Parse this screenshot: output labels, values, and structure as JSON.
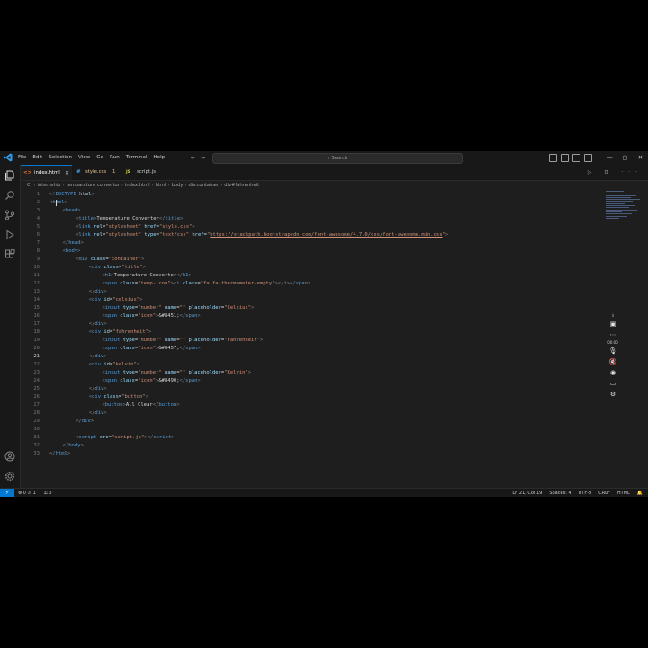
{
  "menu": [
    "File",
    "Edit",
    "Selection",
    "View",
    "Go",
    "Run",
    "Terminal",
    "Help"
  ],
  "nav": {
    "back": "←",
    "forward": "→"
  },
  "search": {
    "placeholder": "Search"
  },
  "window_controls": {
    "minimize": "—",
    "restore": "▢",
    "close": "✕"
  },
  "tabs": [
    {
      "icon": "<>",
      "label": "index.html",
      "close": "✕",
      "active": true,
      "color": "#e37933"
    },
    {
      "icon": "#",
      "label": "style.css",
      "badge": "1",
      "active": false,
      "color": "#42a5f5",
      "label_color": "#e2c08d"
    },
    {
      "icon": "JS",
      "label": "script.js",
      "active": false,
      "color": "#cbcb41"
    }
  ],
  "tab_actions": "▷ ⊡ ···",
  "breadcrumb": [
    "C:",
    "internship",
    "temparature convertor",
    "index.html",
    "html",
    "body",
    "div.container",
    "div#fahrenheit"
  ],
  "editor": {
    "current_line": 21,
    "lines": [
      {
        "n": "1",
        "i": 0,
        "p": [
          [
            "br",
            "<!"
          ],
          [
            "tag",
            "DOCTYPE"
          ],
          [
            "attr",
            " html"
          ],
          [
            "br",
            ">"
          ]
        ]
      },
      {
        "n": "2",
        "i": 0,
        "p": [
          [
            "br",
            "<"
          ],
          [
            "tag",
            "html"
          ],
          [
            "br",
            ">"
          ]
        ]
      },
      {
        "n": "3",
        "i": 1,
        "p": [
          [
            "br",
            "<"
          ],
          [
            "tag",
            "head"
          ],
          [
            "br",
            ">"
          ]
        ]
      },
      {
        "n": "4",
        "i": 2,
        "p": [
          [
            "br",
            "<"
          ],
          [
            "tag",
            "title"
          ],
          [
            "br",
            ">"
          ],
          [
            "txt",
            "Temperature Converter"
          ],
          [
            "br",
            "</"
          ],
          [
            "tag",
            "title"
          ],
          [
            "br",
            ">"
          ]
        ]
      },
      {
        "n": "5",
        "i": 2,
        "p": [
          [
            "br",
            "<"
          ],
          [
            "tag",
            "link"
          ],
          [
            "attr",
            " rel"
          ],
          [
            "txt",
            "="
          ],
          [
            "str",
            "\"stylesheet\""
          ],
          [
            "attr",
            " href"
          ],
          [
            "txt",
            "="
          ],
          [
            "str",
            "\"style.css\""
          ],
          [
            "br",
            ">"
          ]
        ]
      },
      {
        "n": "6",
        "i": 2,
        "p": [
          [
            "br",
            "<"
          ],
          [
            "tag",
            "link"
          ],
          [
            "attr",
            " rel"
          ],
          [
            "txt",
            "="
          ],
          [
            "str",
            "\"stylesheet\""
          ],
          [
            "attr",
            " type"
          ],
          [
            "txt",
            "="
          ],
          [
            "str",
            "\"text/css\""
          ],
          [
            "attr",
            " href"
          ],
          [
            "txt",
            "="
          ],
          [
            "str",
            "\""
          ],
          [
            "url",
            "https://stackpath.bootstrapcdn.com/font-awesome/4.7.0/css/font-awesome.min.css"
          ],
          [
            "str",
            "\""
          ],
          [
            "br",
            ">"
          ]
        ]
      },
      {
        "n": "7",
        "i": 1,
        "p": [
          [
            "br",
            "</"
          ],
          [
            "tag",
            "head"
          ],
          [
            "br",
            ">"
          ]
        ]
      },
      {
        "n": "8",
        "i": 1,
        "p": [
          [
            "br",
            "<"
          ],
          [
            "tag",
            "body"
          ],
          [
            "br",
            ">"
          ]
        ]
      },
      {
        "n": "9",
        "i": 2,
        "p": [
          [
            "br",
            "<"
          ],
          [
            "tag",
            "div"
          ],
          [
            "attr",
            " class"
          ],
          [
            "txt",
            "="
          ],
          [
            "str",
            "\"container\""
          ],
          [
            "br",
            ">"
          ]
        ]
      },
      {
        "n": "10",
        "i": 3,
        "p": [
          [
            "br",
            "<"
          ],
          [
            "tag",
            "div"
          ],
          [
            "attr",
            " class"
          ],
          [
            "txt",
            "="
          ],
          [
            "str",
            "\"title\""
          ],
          [
            "br",
            ">"
          ]
        ]
      },
      {
        "n": "11",
        "i": 4,
        "p": [
          [
            "br",
            "<"
          ],
          [
            "tag",
            "h1"
          ],
          [
            "br",
            ">"
          ],
          [
            "txt",
            "Temperature Converter"
          ],
          [
            "br",
            "</"
          ],
          [
            "tag",
            "h1"
          ],
          [
            "br",
            ">"
          ]
        ]
      },
      {
        "n": "12",
        "i": 4,
        "p": [
          [
            "br",
            "<"
          ],
          [
            "tag",
            "span"
          ],
          [
            "attr",
            " class"
          ],
          [
            "txt",
            "="
          ],
          [
            "str",
            "\"temp-icon\""
          ],
          [
            "br",
            "><"
          ],
          [
            "tag",
            "i"
          ],
          [
            "attr",
            " class"
          ],
          [
            "txt",
            "="
          ],
          [
            "str",
            "\"fa fa-thermometer-empty\""
          ],
          [
            "br",
            "></"
          ],
          [
            "tag",
            "i"
          ],
          [
            "br",
            "></"
          ],
          [
            "tag",
            "span"
          ],
          [
            "br",
            ">"
          ]
        ]
      },
      {
        "n": "13",
        "i": 3,
        "p": [
          [
            "br",
            "</"
          ],
          [
            "tag",
            "div"
          ],
          [
            "br",
            ">"
          ]
        ]
      },
      {
        "n": "14",
        "i": 3,
        "p": [
          [
            "br",
            "<"
          ],
          [
            "tag",
            "div"
          ],
          [
            "attr",
            " id"
          ],
          [
            "txt",
            "="
          ],
          [
            "str",
            "\"celsius\""
          ],
          [
            "br",
            ">"
          ]
        ]
      },
      {
        "n": "15",
        "i": 4,
        "p": [
          [
            "br",
            "<"
          ],
          [
            "tag",
            "input"
          ],
          [
            "attr",
            " type"
          ],
          [
            "txt",
            "="
          ],
          [
            "str",
            "\"number\""
          ],
          [
            "attr",
            " name"
          ],
          [
            "txt",
            "="
          ],
          [
            "str",
            "\"\""
          ],
          [
            "attr",
            " placeholder"
          ],
          [
            "txt",
            "="
          ],
          [
            "str",
            "\"Celsius\""
          ],
          [
            "br",
            ">"
          ]
        ]
      },
      {
        "n": "16",
        "i": 4,
        "p": [
          [
            "br",
            "<"
          ],
          [
            "tag",
            "span"
          ],
          [
            "attr",
            " class"
          ],
          [
            "txt",
            "="
          ],
          [
            "str",
            "\"icon\""
          ],
          [
            "br",
            ">"
          ],
          [
            "ent",
            "&#8451;"
          ],
          [
            "br",
            "</"
          ],
          [
            "tag",
            "span"
          ],
          [
            "br",
            ">"
          ]
        ]
      },
      {
        "n": "17",
        "i": 3,
        "p": [
          [
            "br",
            "</"
          ],
          [
            "tag",
            "div"
          ],
          [
            "br",
            ">"
          ]
        ]
      },
      {
        "n": "18",
        "i": 3,
        "p": [
          [
            "br",
            "<"
          ],
          [
            "tag",
            "div"
          ],
          [
            "attr",
            " id"
          ],
          [
            "txt",
            "="
          ],
          [
            "str",
            "\"fahrenheit\""
          ],
          [
            "br",
            ">"
          ]
        ]
      },
      {
        "n": "19",
        "i": 4,
        "p": [
          [
            "br",
            "<"
          ],
          [
            "tag",
            "input"
          ],
          [
            "attr",
            " type"
          ],
          [
            "txt",
            "="
          ],
          [
            "str",
            "\"number\""
          ],
          [
            "attr",
            " name"
          ],
          [
            "txt",
            "="
          ],
          [
            "str",
            "\"\""
          ],
          [
            "attr",
            " placeholder"
          ],
          [
            "txt",
            "="
          ],
          [
            "str",
            "\"Fahrenheit\""
          ],
          [
            "br",
            ">"
          ]
        ]
      },
      {
        "n": "20",
        "i": 4,
        "p": [
          [
            "br",
            "<"
          ],
          [
            "tag",
            "span"
          ],
          [
            "attr",
            " class"
          ],
          [
            "txt",
            "="
          ],
          [
            "str",
            "\"icon\""
          ],
          [
            "br",
            ">"
          ],
          [
            "ent",
            "&#8457;"
          ],
          [
            "br",
            "</"
          ],
          [
            "tag",
            "span"
          ],
          [
            "br",
            ">"
          ]
        ]
      },
      {
        "n": "21",
        "i": 3,
        "p": [
          [
            "br",
            "</"
          ],
          [
            "tag",
            "div"
          ],
          [
            "br",
            ">"
          ]
        ]
      },
      {
        "n": "22",
        "i": 3,
        "p": [
          [
            "br",
            "<"
          ],
          [
            "tag",
            "div"
          ],
          [
            "attr",
            " id"
          ],
          [
            "txt",
            "="
          ],
          [
            "str",
            "\"kelvin\""
          ],
          [
            "br",
            ">"
          ]
        ]
      },
      {
        "n": "23",
        "i": 4,
        "p": [
          [
            "br",
            "<"
          ],
          [
            "tag",
            "input"
          ],
          [
            "attr",
            " type"
          ],
          [
            "txt",
            "="
          ],
          [
            "str",
            "\"number\""
          ],
          [
            "attr",
            " name"
          ],
          [
            "txt",
            "="
          ],
          [
            "str",
            "\"\""
          ],
          [
            "attr",
            " placeholder"
          ],
          [
            "txt",
            "="
          ],
          [
            "str",
            "\"Kelvin\""
          ],
          [
            "br",
            ">"
          ]
        ]
      },
      {
        "n": "24",
        "i": 4,
        "p": [
          [
            "br",
            "<"
          ],
          [
            "tag",
            "span"
          ],
          [
            "attr",
            " class"
          ],
          [
            "txt",
            "="
          ],
          [
            "str",
            "\"icon\""
          ],
          [
            "br",
            ">"
          ],
          [
            "ent",
            "&#8490;"
          ],
          [
            "br",
            "</"
          ],
          [
            "tag",
            "span"
          ],
          [
            "br",
            ">"
          ]
        ]
      },
      {
        "n": "25",
        "i": 3,
        "p": [
          [
            "br",
            "</"
          ],
          [
            "tag",
            "div"
          ],
          [
            "br",
            ">"
          ]
        ]
      },
      {
        "n": "26",
        "i": 3,
        "p": [
          [
            "br",
            "<"
          ],
          [
            "tag",
            "div"
          ],
          [
            "attr",
            " class"
          ],
          [
            "txt",
            "="
          ],
          [
            "str",
            "\"button\""
          ],
          [
            "br",
            ">"
          ]
        ]
      },
      {
        "n": "27",
        "i": 4,
        "p": [
          [
            "br",
            "<"
          ],
          [
            "tag",
            "button"
          ],
          [
            "br",
            ">"
          ],
          [
            "txt",
            "All Clear"
          ],
          [
            "br",
            "</"
          ],
          [
            "tag",
            "button"
          ],
          [
            "br",
            ">"
          ]
        ]
      },
      {
        "n": "28",
        "i": 3,
        "p": [
          [
            "br",
            "</"
          ],
          [
            "tag",
            "div"
          ],
          [
            "br",
            ">"
          ]
        ]
      },
      {
        "n": "29",
        "i": 2,
        "p": [
          [
            "br",
            "</"
          ],
          [
            "tag",
            "div"
          ],
          [
            "br",
            ">"
          ]
        ]
      },
      {
        "n": "30",
        "i": 0,
        "p": []
      },
      {
        "n": "31",
        "i": 2,
        "p": [
          [
            "br",
            "<"
          ],
          [
            "tag",
            "script"
          ],
          [
            "attr",
            " src"
          ],
          [
            "txt",
            "="
          ],
          [
            "str",
            "\"script.js\""
          ],
          [
            "br",
            "></"
          ],
          [
            "tag",
            "script"
          ],
          [
            "br",
            ">"
          ]
        ]
      },
      {
        "n": "32",
        "i": 1,
        "p": [
          [
            "br",
            "</"
          ],
          [
            "tag",
            "body"
          ],
          [
            "br",
            ">"
          ]
        ]
      },
      {
        "n": "33",
        "i": 0,
        "p": [
          [
            "br",
            "</"
          ],
          [
            "tag",
            "html"
          ],
          [
            "br",
            ">"
          ]
        ]
      }
    ]
  },
  "float_toolbar": {
    "time": "00:00"
  },
  "status": {
    "remote": "⚡",
    "problems": "⊗ 0 ⚠ 1",
    "ports": "⚿ 0",
    "position": "Ln 21, Col 19",
    "spaces": "Spaces: 4",
    "encoding": "UTF-8",
    "eol": "CRLF",
    "language": "HTML",
    "notifications": "🔔"
  }
}
